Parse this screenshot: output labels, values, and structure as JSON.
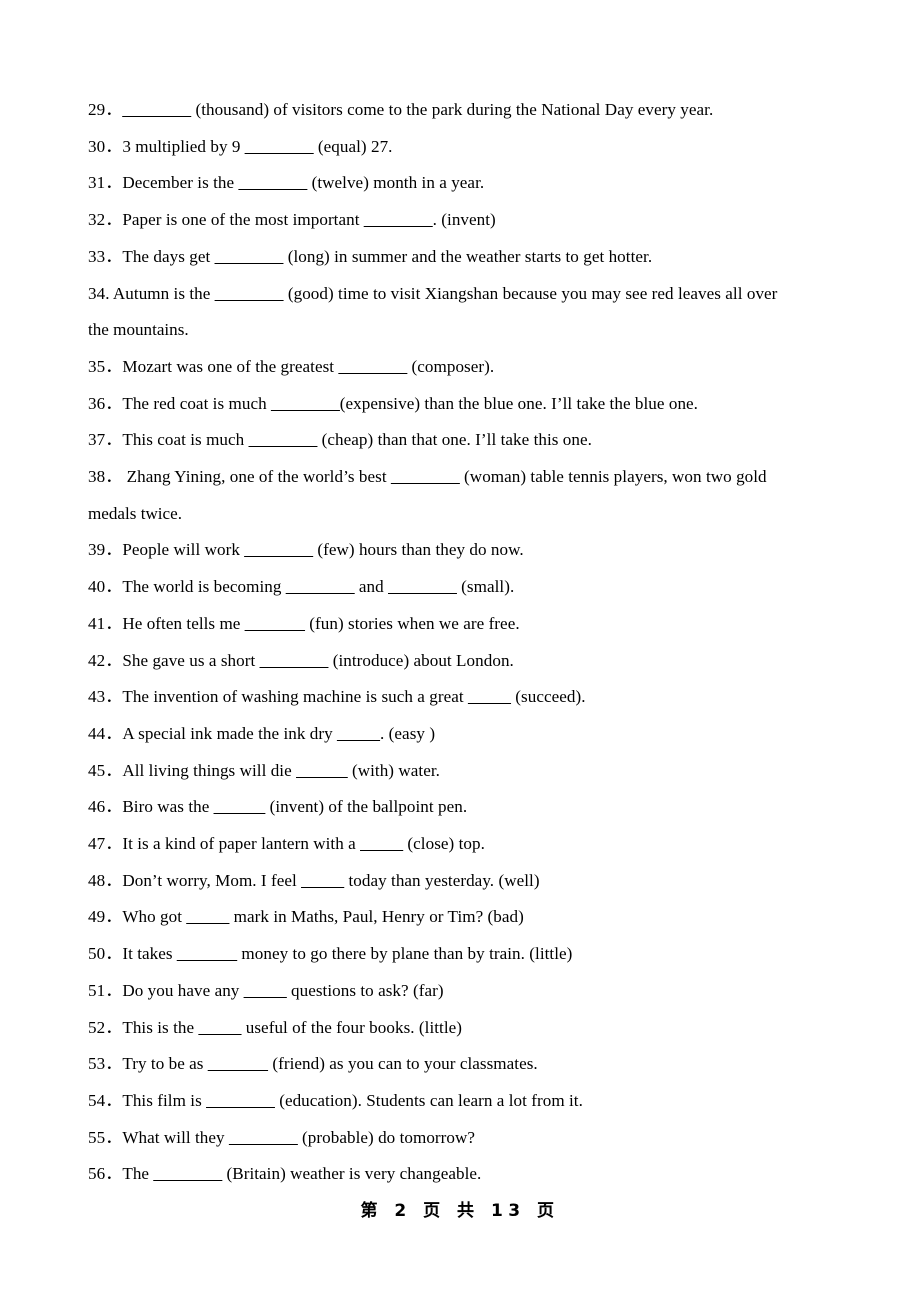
{
  "page": {
    "background_color": "#ffffff",
    "text_color": "#000000"
  },
  "worksheet": {
    "items": [
      {
        "number": "29．",
        "segments": [
          {
            "type": "blank",
            "text": "________"
          },
          {
            "type": "text",
            "text": " (thousand) of visitors come to the park during the National Day every year."
          }
        ],
        "continuation": null
      },
      {
        "number": "30．",
        "segments": [
          {
            "type": "text",
            "text": "3 multiplied by 9 "
          },
          {
            "type": "blank",
            "text": "________"
          },
          {
            "type": "text",
            "text": " (equal) 27."
          }
        ],
        "continuation": null
      },
      {
        "number": "31．",
        "segments": [
          {
            "type": "text",
            "text": "December is the "
          },
          {
            "type": "blank",
            "text": "________"
          },
          {
            "type": "text",
            "text": " (twelve) month in a year."
          }
        ],
        "continuation": null
      },
      {
        "number": "32．",
        "segments": [
          {
            "type": "text",
            "text": "Paper is one of the most important "
          },
          {
            "type": "blank",
            "text": "________"
          },
          {
            "type": "text",
            "text": ". (invent)"
          }
        ],
        "continuation": null
      },
      {
        "number": "33．",
        "segments": [
          {
            "type": "text",
            "text": "The days get "
          },
          {
            "type": "blank",
            "text": "________"
          },
          {
            "type": "text",
            "text": " (long) in summer and the weather starts to get hotter."
          }
        ],
        "continuation": null
      },
      {
        "number": "34. ",
        "segments": [
          {
            "type": "text",
            "text": "Autumn is the "
          },
          {
            "type": "blank",
            "text": "________"
          },
          {
            "type": "text",
            "text": " (good) time to visit Xiangshan because you may see red leaves all over"
          }
        ],
        "continuation": "the mountains."
      },
      {
        "number": "35．",
        "segments": [
          {
            "type": "text",
            "text": "Mozart was one of the greatest "
          },
          {
            "type": "blank",
            "text": "________"
          },
          {
            "type": "text",
            "text": " (composer)."
          }
        ],
        "continuation": null
      },
      {
        "number": "36．",
        "segments": [
          {
            "type": "text",
            "text": "The red coat is much "
          },
          {
            "type": "blank",
            "text": "________"
          },
          {
            "type": "text",
            "text": "(expensive) than the blue one. I’ll take the blue one."
          }
        ],
        "continuation": null
      },
      {
        "number": "37．",
        "segments": [
          {
            "type": "text",
            "text": "This coat is much "
          },
          {
            "type": "blank",
            "text": "________"
          },
          {
            "type": "text",
            "text": " (cheap) than that one. I’ll take this one."
          }
        ],
        "continuation": null
      },
      {
        "number": "38． ",
        "segments": [
          {
            "type": "text",
            "text": "Zhang Yining, one of the world’s best "
          },
          {
            "type": "blank",
            "text": "________"
          },
          {
            "type": "text",
            "text": " (woman) table tennis players, won two gold"
          }
        ],
        "continuation": "medals twice."
      },
      {
        "number": "39．",
        "segments": [
          {
            "type": "text",
            "text": "People will work "
          },
          {
            "type": "blank",
            "text": "________"
          },
          {
            "type": "text",
            "text": " (few) hours than they do now."
          }
        ],
        "continuation": null
      },
      {
        "number": "40．",
        "segments": [
          {
            "type": "text",
            "text": "The world is becoming "
          },
          {
            "type": "blank",
            "text": "________"
          },
          {
            "type": "text",
            "text": " and "
          },
          {
            "type": "blank",
            "text": "________"
          },
          {
            "type": "text",
            "text": " (small)."
          }
        ],
        "continuation": null
      },
      {
        "number": "41．",
        "segments": [
          {
            "type": "text",
            "text": "He often tells me "
          },
          {
            "type": "blank",
            "text": "_______"
          },
          {
            "type": "text",
            "text": " (fun) stories when we are free."
          }
        ],
        "continuation": null
      },
      {
        "number": "42．",
        "segments": [
          {
            "type": "text",
            "text": "She gave us a short "
          },
          {
            "type": "blank",
            "text": "________"
          },
          {
            "type": "text",
            "text": " (introduce) about London."
          }
        ],
        "continuation": null
      },
      {
        "number": "43．",
        "segments": [
          {
            "type": "text",
            "text": "The invention of washing machine is such a great "
          },
          {
            "type": "blank",
            "text": "_____"
          },
          {
            "type": "text",
            "text": " (succeed)."
          }
        ],
        "continuation": null
      },
      {
        "number": "44．",
        "segments": [
          {
            "type": "text",
            "text": "A special ink made the ink dry "
          },
          {
            "type": "blank",
            "text": "_____"
          },
          {
            "type": "text",
            "text": ". (easy )"
          }
        ],
        "continuation": null
      },
      {
        "number": "45．",
        "segments": [
          {
            "type": "text",
            "text": "All living things will die "
          },
          {
            "type": "blank",
            "text": "______"
          },
          {
            "type": "text",
            "text": " (with) water."
          }
        ],
        "continuation": null
      },
      {
        "number": "46．",
        "segments": [
          {
            "type": "text",
            "text": "Biro was the "
          },
          {
            "type": "blank",
            "text": "______"
          },
          {
            "type": "text",
            "text": " (invent) of the ballpoint pen."
          }
        ],
        "continuation": null
      },
      {
        "number": "47．",
        "segments": [
          {
            "type": "text",
            "text": "It is a kind of paper lantern with a "
          },
          {
            "type": "blank",
            "text": "_____"
          },
          {
            "type": "text",
            "text": " (close) top."
          }
        ],
        "continuation": null
      },
      {
        "number": "48．",
        "segments": [
          {
            "type": "text",
            "text": "Don’t worry, Mom. I feel "
          },
          {
            "type": "blank",
            "text": "_____"
          },
          {
            "type": "text",
            "text": " today than yesterday. (well)"
          }
        ],
        "continuation": null
      },
      {
        "number": "49．",
        "segments": [
          {
            "type": "text",
            "text": "Who got "
          },
          {
            "type": "blank",
            "text": "_____"
          },
          {
            "type": "text",
            "text": " mark in Maths, Paul, Henry or Tim? (bad)"
          }
        ],
        "continuation": null
      },
      {
        "number": "50．",
        "segments": [
          {
            "type": "text",
            "text": "It takes "
          },
          {
            "type": "blank",
            "text": "_______"
          },
          {
            "type": "text",
            "text": " money to go there by plane than by train. (little)"
          }
        ],
        "continuation": null
      },
      {
        "number": "51．",
        "segments": [
          {
            "type": "text",
            "text": "Do you have any "
          },
          {
            "type": "blank",
            "text": "_____"
          },
          {
            "type": "text",
            "text": " questions to ask? (far)"
          }
        ],
        "continuation": null
      },
      {
        "number": "52．",
        "segments": [
          {
            "type": "text",
            "text": "This is the "
          },
          {
            "type": "blank",
            "text": "_____"
          },
          {
            "type": "text",
            "text": " useful of the four books. (little)"
          }
        ],
        "continuation": null
      },
      {
        "number": "53．",
        "segments": [
          {
            "type": "text",
            "text": "Try to be as "
          },
          {
            "type": "blank",
            "text": "_______"
          },
          {
            "type": "text",
            "text": " (friend) as you can to your classmates."
          }
        ],
        "continuation": null
      },
      {
        "number": "54．",
        "segments": [
          {
            "type": "text",
            "text": "This film is "
          },
          {
            "type": "blank",
            "text": "________"
          },
          {
            "type": "text",
            "text": " (education). Students can learn a lot from it."
          }
        ],
        "continuation": null
      },
      {
        "number": "55．",
        "segments": [
          {
            "type": "text",
            "text": "What will they "
          },
          {
            "type": "blank",
            "text": "________"
          },
          {
            "type": "text",
            "text": " (probable) do tomorrow?"
          }
        ],
        "continuation": null
      },
      {
        "number": "56．",
        "segments": [
          {
            "type": "text",
            "text": "The "
          },
          {
            "type": "blank",
            "text": "________"
          },
          {
            "type": "text",
            "text": " (Britain) weather is very changeable."
          }
        ],
        "continuation": null
      }
    ]
  },
  "footer": {
    "text": "第 2 页 共 13 页",
    "current_page": "2",
    "total_pages": "13"
  }
}
